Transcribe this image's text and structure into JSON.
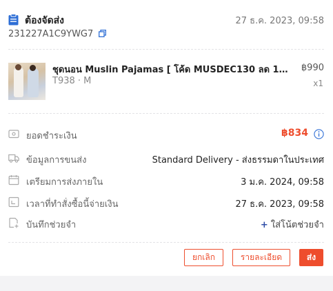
{
  "order": {
    "status": "ต้องจัดส่ง",
    "created_at": "27 ธ.ค. 2023, 09:58",
    "order_id": "231227A1C9YWG7"
  },
  "product": {
    "name": "ชุดนอน Muslin Pajamas [ โค้ด MUSDEC130 ลด 130 ...",
    "variant": "T938 · M",
    "price": "฿990",
    "quantity": "x1"
  },
  "details": {
    "total_label": "ยอดชำระเงิน",
    "total_value": "฿834",
    "shipping_label": "ข้อมูลการขนส่ง",
    "shipping_value": "Standard Delivery - ส่งธรรมดาในประเทศ",
    "prepare_label": "เตรียมการส่งภายใน",
    "prepare_value": "3 ม.ค. 2024, 09:58",
    "ordered_label": "เวลาที่ทำสั่งซื้อนี้จ่ายเงิน",
    "ordered_value": "27 ธ.ค. 2023, 09:58",
    "note_label": "บันทึกช่วยจำ",
    "note_action": "ใส่โน้ตช่วยจำ",
    "note_plus": "+"
  },
  "actions": {
    "cancel": "ยกเลิก",
    "detail": "รายละเอียด",
    "ship": "ส่ง"
  },
  "colors": {
    "accent": "#ee4d2d",
    "status_icon": "#2f6fd6",
    "link": "#2f4ea7"
  },
  "icons": [
    "clipboard-icon",
    "copy-icon",
    "wallet-icon",
    "truck-icon",
    "calendar-icon",
    "clock-icon",
    "note-add-icon",
    "info-icon"
  ]
}
